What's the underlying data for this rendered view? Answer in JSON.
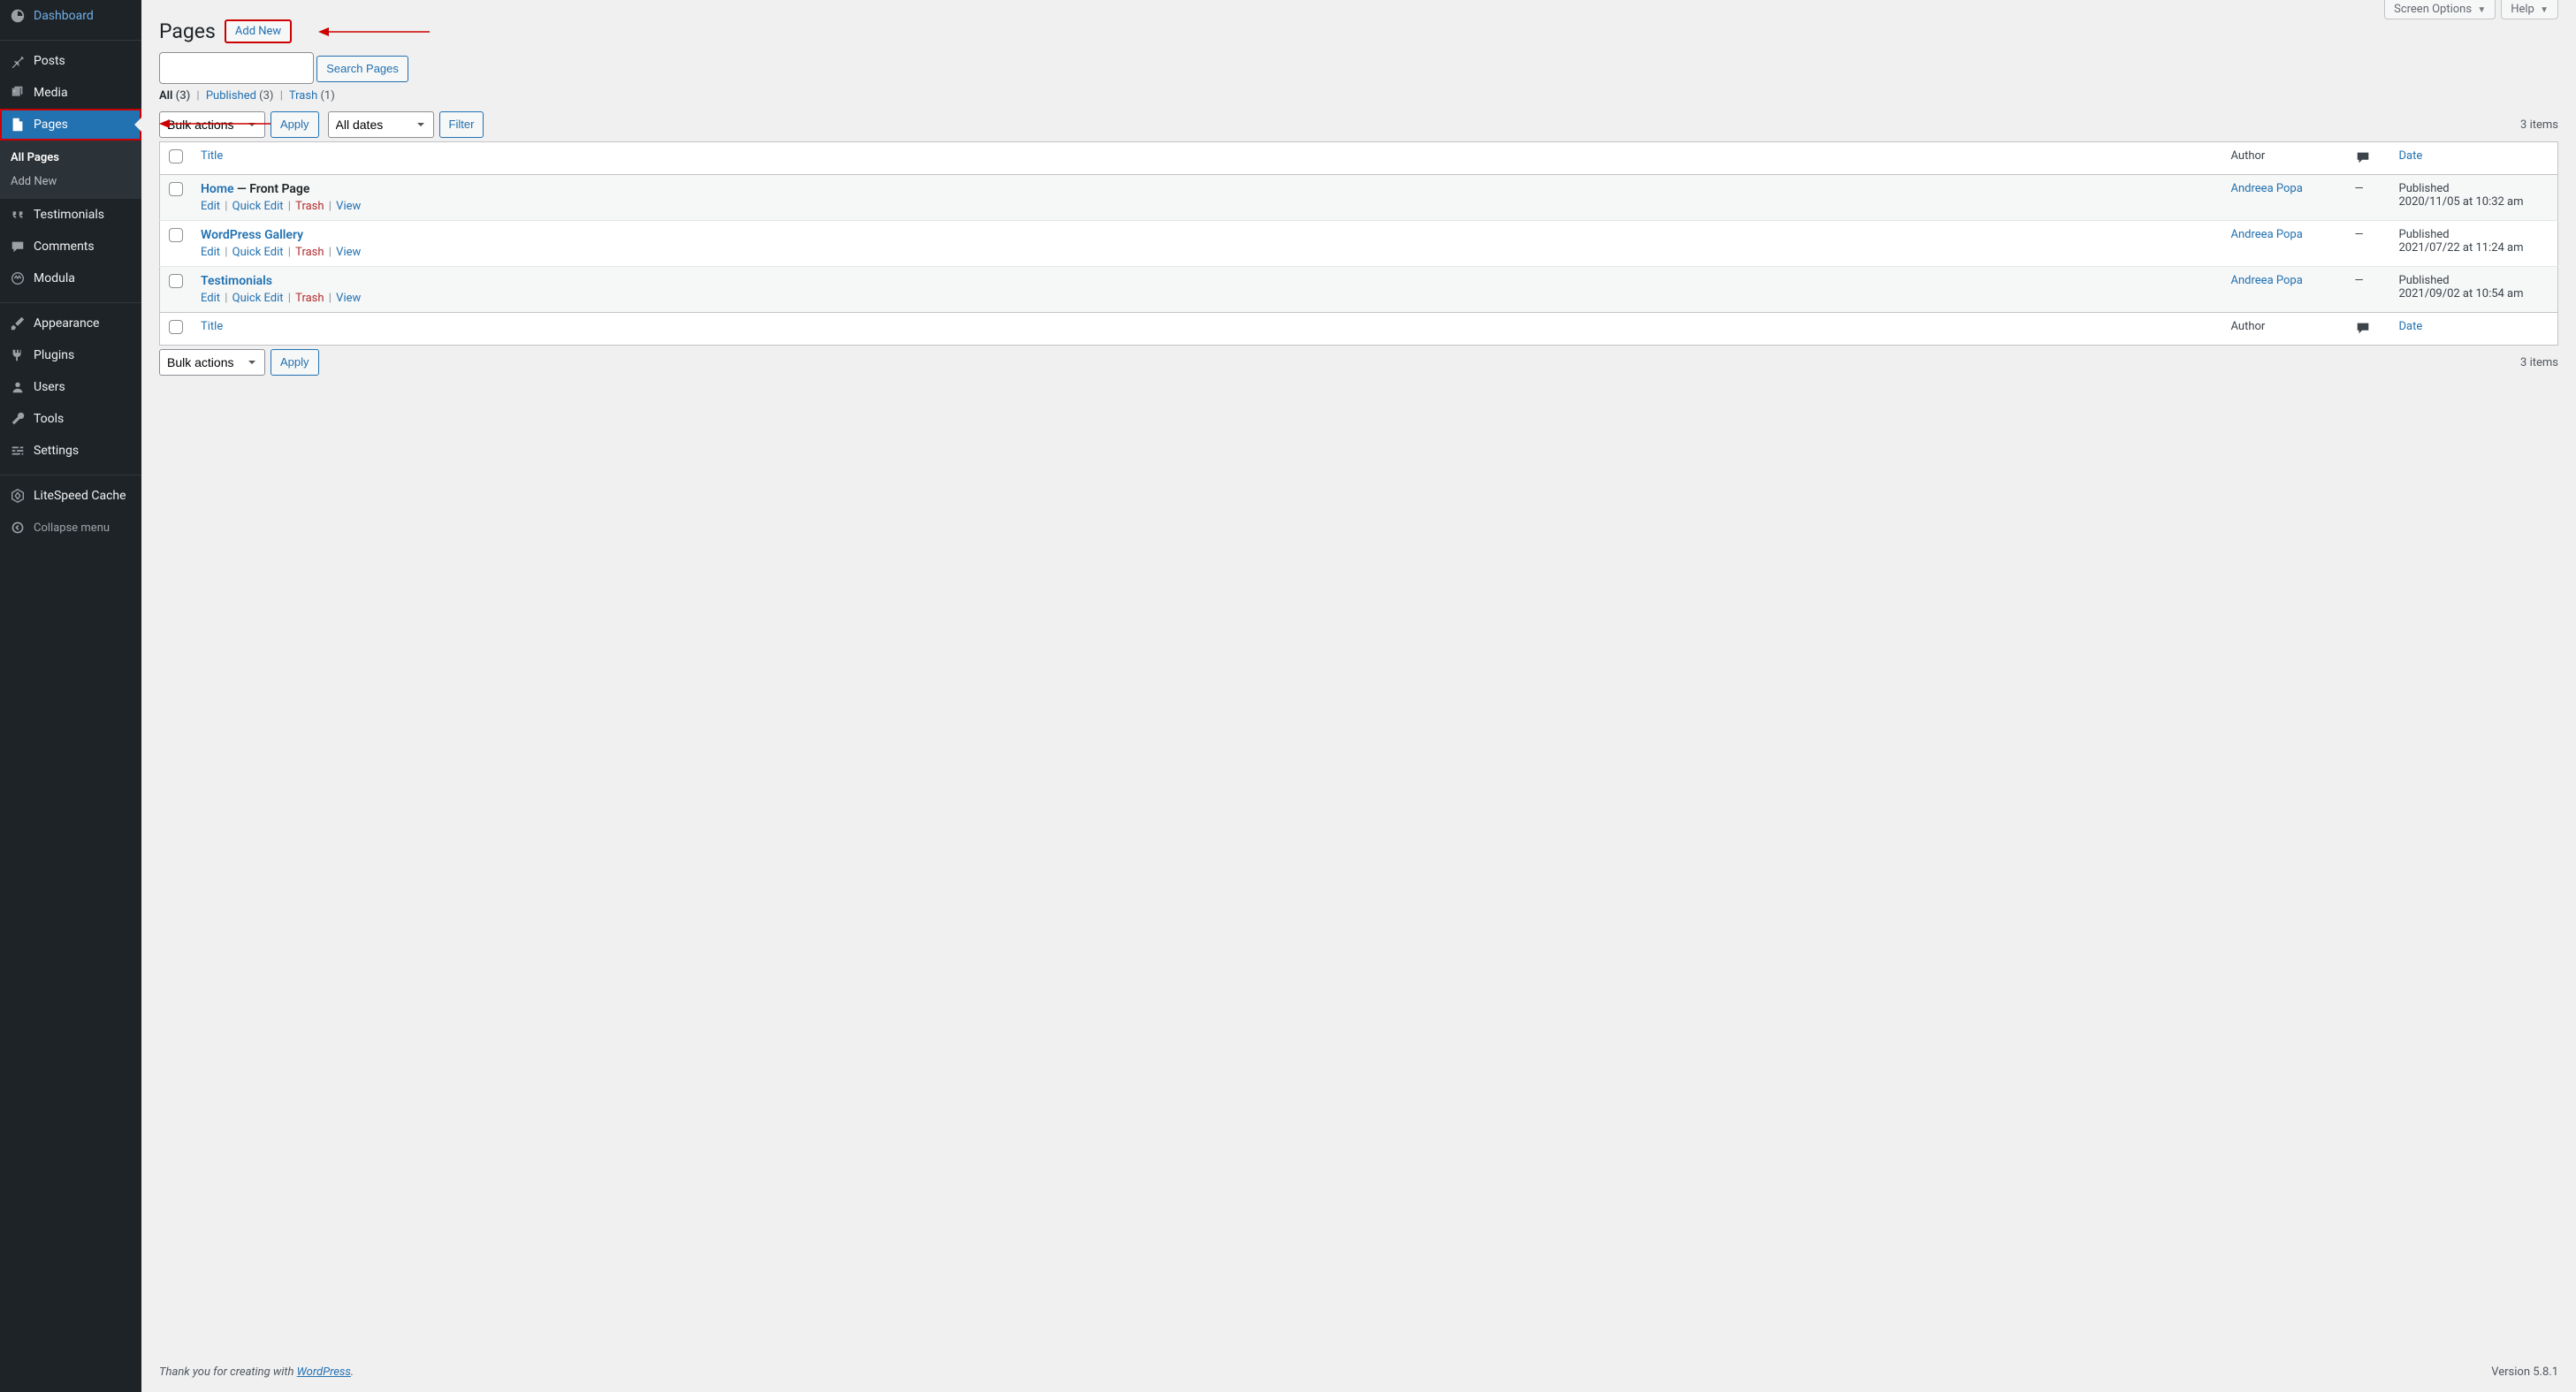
{
  "sidebar": {
    "items": [
      {
        "id": "dashboard",
        "label": "Dashboard"
      },
      {
        "id": "posts",
        "label": "Posts"
      },
      {
        "id": "media",
        "label": "Media"
      },
      {
        "id": "pages",
        "label": "Pages"
      },
      {
        "id": "testimonials",
        "label": "Testimonials"
      },
      {
        "id": "comments",
        "label": "Comments"
      },
      {
        "id": "modula",
        "label": "Modula"
      },
      {
        "id": "appearance",
        "label": "Appearance"
      },
      {
        "id": "plugins",
        "label": "Plugins"
      },
      {
        "id": "users",
        "label": "Users"
      },
      {
        "id": "tools",
        "label": "Tools"
      },
      {
        "id": "settings",
        "label": "Settings"
      },
      {
        "id": "litespeed",
        "label": "LiteSpeed Cache"
      }
    ],
    "submenu": {
      "all_pages": "All Pages",
      "add_new": "Add New"
    },
    "collapse": "Collapse menu"
  },
  "top_tabs": {
    "screen_options": "Screen Options",
    "help": "Help"
  },
  "header": {
    "title": "Pages",
    "add_new": "Add New"
  },
  "filters": {
    "all": "All",
    "all_count": "(3)",
    "published": "Published",
    "published_count": "(3)",
    "trash": "Trash",
    "trash_count": "(1)"
  },
  "search": {
    "button": "Search Pages"
  },
  "bulk": {
    "label": "Bulk actions",
    "apply": "Apply",
    "all_dates": "All dates",
    "filter": "Filter",
    "items_count": "3 items"
  },
  "columns": {
    "title": "Title",
    "author": "Author",
    "date": "Date"
  },
  "row_actions": {
    "edit": "Edit",
    "quick_edit": "Quick Edit",
    "trash": "Trash",
    "view": "View"
  },
  "rows": [
    {
      "title": "Home",
      "state": " — Front Page",
      "author": "Andreea Popa",
      "comments": "—",
      "date_status": "Published",
      "date_value": "2020/11/05 at 10:32 am"
    },
    {
      "title": "WordPress Gallery",
      "state": "",
      "author": "Andreea Popa",
      "comments": "—",
      "date_status": "Published",
      "date_value": "2021/07/22 at 11:24 am"
    },
    {
      "title": "Testimonials",
      "state": "",
      "author": "Andreea Popa",
      "comments": "—",
      "date_status": "Published",
      "date_value": "2021/09/02 at 10:54 am"
    }
  ],
  "footer": {
    "thanks_prefix": "Thank you for creating with ",
    "thanks_link": "WordPress",
    "thanks_suffix": ".",
    "version": "Version 5.8.1"
  }
}
